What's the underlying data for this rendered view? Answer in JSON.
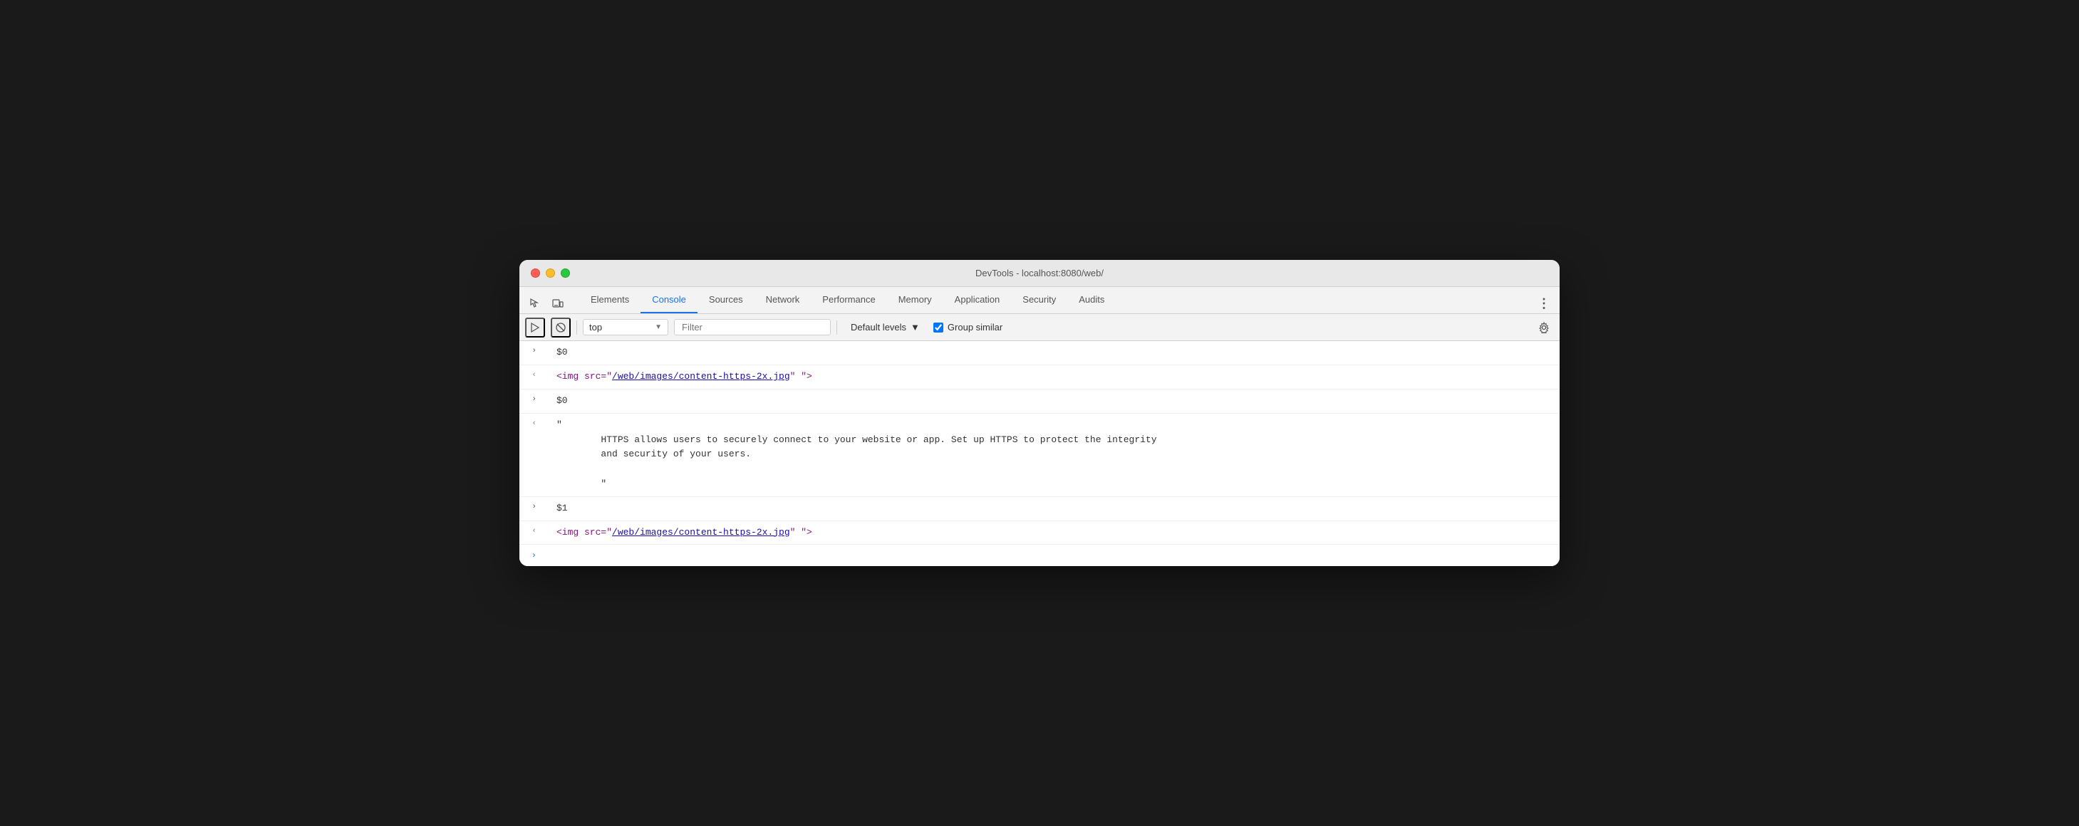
{
  "window": {
    "title": "DevTools - localhost:8080/web/"
  },
  "traffic_lights": {
    "close_label": "close",
    "minimize_label": "minimize",
    "maximize_label": "maximize"
  },
  "tabs": [
    {
      "id": "elements",
      "label": "Elements",
      "active": false
    },
    {
      "id": "console",
      "label": "Console",
      "active": true
    },
    {
      "id": "sources",
      "label": "Sources",
      "active": false
    },
    {
      "id": "network",
      "label": "Network",
      "active": false
    },
    {
      "id": "performance",
      "label": "Performance",
      "active": false
    },
    {
      "id": "memory",
      "label": "Memory",
      "active": false
    },
    {
      "id": "application",
      "label": "Application",
      "active": false
    },
    {
      "id": "security",
      "label": "Security",
      "active": false
    },
    {
      "id": "audits",
      "label": "Audits",
      "active": false
    }
  ],
  "toolbar": {
    "execute_icon": "▶",
    "clear_icon": "🚫",
    "context_label": "top",
    "filter_placeholder": "Filter",
    "levels_label": "Default levels",
    "group_similar_label": "Group similar",
    "gear_icon": "⚙"
  },
  "console": {
    "entries": [
      {
        "type": "input",
        "arrow": ">",
        "content": "$0"
      },
      {
        "type": "output",
        "arrow": "<",
        "html_prefix": "<img src=\"",
        "html_link": "/web/images/content-https-2x.jpg",
        "html_suffix": "\" \">"
      },
      {
        "type": "input",
        "arrow": ">",
        "content": "$0"
      },
      {
        "type": "output_text",
        "arrow": "<",
        "quote_open": "\"",
        "text_line1": "        HTTPS allows users to securely connect to your website or app. Set up HTTPS to protect the integrity",
        "text_line2": "        and security of your users.",
        "text_line3": "",
        "text_line4": "        \"",
        "quote_close": ""
      },
      {
        "type": "input",
        "arrow": ">",
        "content": "$1"
      },
      {
        "type": "output",
        "arrow": "<",
        "html_prefix": "<img src=\"",
        "html_link": "/web/images/content-https-2x.jpg",
        "html_suffix": "\" \">"
      }
    ],
    "input_arrow": ">",
    "input_cursor": "|"
  }
}
